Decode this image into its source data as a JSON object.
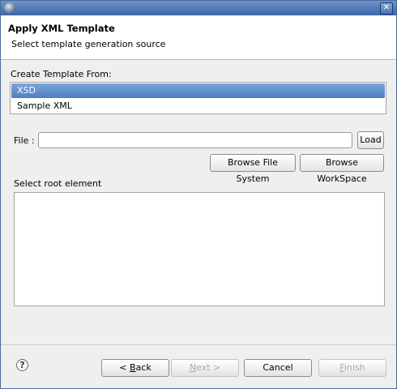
{
  "window": {
    "close_glyph": "✕"
  },
  "header": {
    "title": "Apply XML Template",
    "subtitle": "Select template generation source"
  },
  "source": {
    "label": "Create Template From:",
    "items": [
      {
        "label": "XSD",
        "selected": true
      },
      {
        "label": "Sample XML",
        "selected": false
      }
    ]
  },
  "file": {
    "label": "File :",
    "value": "",
    "load_label": "Load",
    "browse_fs_label": "Browse File System",
    "browse_ws_label": "Browse WorkSpace"
  },
  "root": {
    "label": "Select root element"
  },
  "footer": {
    "help_glyph": "?",
    "back_prefix": "< ",
    "back_mnemonic": "B",
    "back_rest": "ack",
    "next_mnemonic": "N",
    "next_rest": "ext >",
    "cancel_label": "Cancel",
    "finish_mnemonic": "F",
    "finish_rest": "inish"
  },
  "colors": {
    "accent": "#4f7ec1",
    "titlebar": "#3c66a8"
  }
}
